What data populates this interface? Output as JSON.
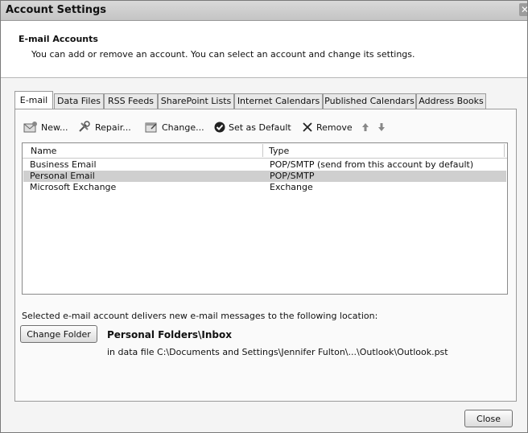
{
  "window": {
    "title": "Account Settings"
  },
  "header": {
    "title": "E-mail Accounts",
    "description": "You can add or remove an account. You can select an account and change its settings."
  },
  "tabs": [
    {
      "label": "E-mail",
      "active": true
    },
    {
      "label": "Data Files"
    },
    {
      "label": "RSS Feeds"
    },
    {
      "label": "SharePoint Lists"
    },
    {
      "label": "Internet Calendars"
    },
    {
      "label": "Published Calendars"
    },
    {
      "label": "Address Books"
    }
  ],
  "toolbar": {
    "new_label": "New...",
    "repair_label": "Repair...",
    "change_label": "Change...",
    "set_default_label": "Set as Default",
    "remove_label": "Remove"
  },
  "accounts": {
    "columns": {
      "name": "Name",
      "type": "Type"
    },
    "rows": [
      {
        "name": "Business Email",
        "type": "POP/SMTP (send from this account by default)"
      },
      {
        "name": "Personal Email",
        "type": "POP/SMTP",
        "selected": true
      },
      {
        "name": "Microsoft Exchange",
        "type": "Exchange"
      }
    ]
  },
  "delivery": {
    "description": "Selected e-mail account delivers new e-mail messages to the following location:",
    "change_folder_label": "Change Folder",
    "folder": "Personal Folders\\Inbox",
    "data_file": "in data file C:\\Documents and Settings\\Jennifer Fulton\\...\\Outlook\\Outlook.pst"
  },
  "footer": {
    "close_label": "Close"
  },
  "colors": {
    "selected_row": "#cfcfcf",
    "titlebar": "#d0d0d0",
    "window_bg": "#f4f4f4"
  }
}
